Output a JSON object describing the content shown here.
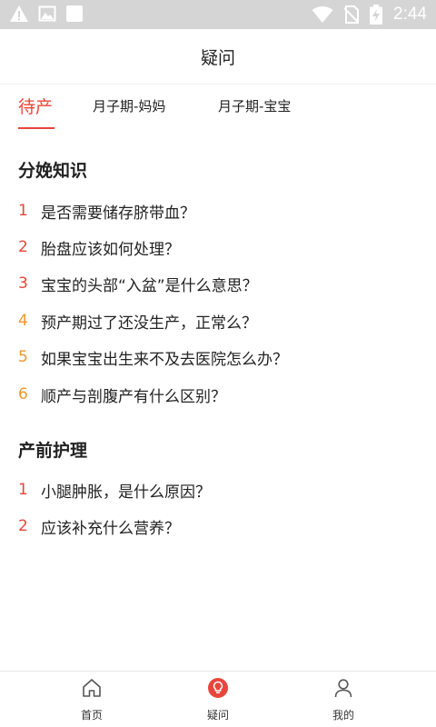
{
  "status_bar": {
    "time": "2:44",
    "left_icons": [
      "warning-icon",
      "image-icon",
      "blank-square-icon"
    ],
    "right_icons": [
      "wifi-icon",
      "no-sim-icon",
      "battery-charging-icon"
    ]
  },
  "header": {
    "title": "疑问"
  },
  "tabs": [
    {
      "label": "待产",
      "active": true
    },
    {
      "label": "月子期-妈妈",
      "active": false
    },
    {
      "label": "月子期-宝宝",
      "active": false
    }
  ],
  "sections": [
    {
      "title": "分娩知识",
      "items": [
        {
          "num": "1",
          "text": "是否需要储存脐带血？"
        },
        {
          "num": "2",
          "text": "胎盘应该如何处理？"
        },
        {
          "num": "3",
          "text": "宝宝的头部“入盆”是什么意思？"
        },
        {
          "num": "4",
          "text": "预产期过了还没生产，正常么？"
        },
        {
          "num": "5",
          "text": "如果宝宝出生来不及去医院怎么办？"
        },
        {
          "num": "6",
          "text": "顺产与剖腹产有什么区别？"
        }
      ]
    },
    {
      "title": "产前护理",
      "items": [
        {
          "num": "1",
          "text": "小腿肿胀，是什么原因？"
        },
        {
          "num": "2",
          "text": "应该补充什么营养？"
        }
      ]
    }
  ],
  "bottom_nav": [
    {
      "label": "首页",
      "icon": "home-icon",
      "active": false
    },
    {
      "label": "疑问",
      "icon": "question-bulb-icon",
      "active": true
    },
    {
      "label": "我的",
      "icon": "user-icon",
      "active": false
    }
  ],
  "colors": {
    "accent": "#e8453c",
    "number_red": "#e8453c",
    "number_orange": "#f0962e",
    "status_bar_bg": "#d5d5d5"
  }
}
